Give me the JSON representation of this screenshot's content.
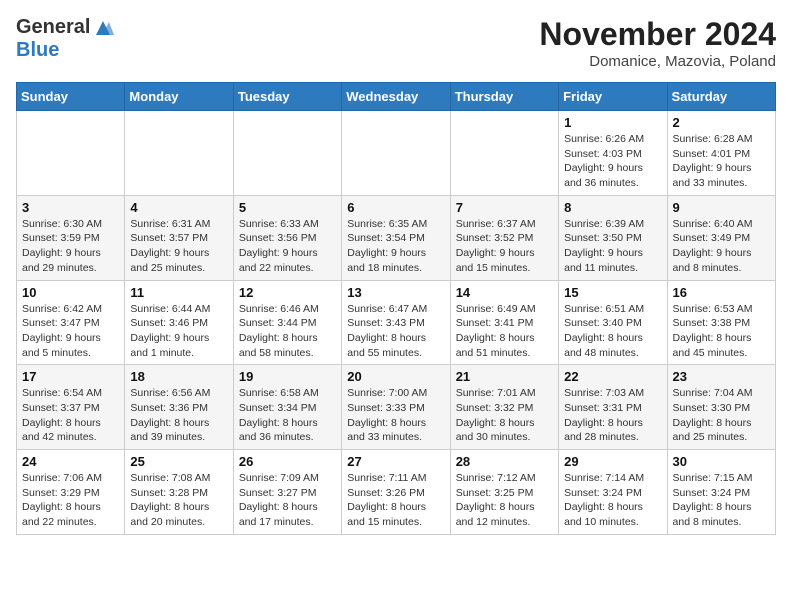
{
  "header": {
    "logo": {
      "text_general": "General",
      "text_blue": "Blue"
    },
    "title": "November 2024",
    "location": "Domanice, Mazovia, Poland"
  },
  "calendar": {
    "days_of_week": [
      "Sunday",
      "Monday",
      "Tuesday",
      "Wednesday",
      "Thursday",
      "Friday",
      "Saturday"
    ],
    "weeks": [
      [
        {
          "day": "",
          "info": ""
        },
        {
          "day": "",
          "info": ""
        },
        {
          "day": "",
          "info": ""
        },
        {
          "day": "",
          "info": ""
        },
        {
          "day": "",
          "info": ""
        },
        {
          "day": "1",
          "info": "Sunrise: 6:26 AM\nSunset: 4:03 PM\nDaylight: 9 hours and 36 minutes."
        },
        {
          "day": "2",
          "info": "Sunrise: 6:28 AM\nSunset: 4:01 PM\nDaylight: 9 hours and 33 minutes."
        }
      ],
      [
        {
          "day": "3",
          "info": "Sunrise: 6:30 AM\nSunset: 3:59 PM\nDaylight: 9 hours and 29 minutes."
        },
        {
          "day": "4",
          "info": "Sunrise: 6:31 AM\nSunset: 3:57 PM\nDaylight: 9 hours and 25 minutes."
        },
        {
          "day": "5",
          "info": "Sunrise: 6:33 AM\nSunset: 3:56 PM\nDaylight: 9 hours and 22 minutes."
        },
        {
          "day": "6",
          "info": "Sunrise: 6:35 AM\nSunset: 3:54 PM\nDaylight: 9 hours and 18 minutes."
        },
        {
          "day": "7",
          "info": "Sunrise: 6:37 AM\nSunset: 3:52 PM\nDaylight: 9 hours and 15 minutes."
        },
        {
          "day": "8",
          "info": "Sunrise: 6:39 AM\nSunset: 3:50 PM\nDaylight: 9 hours and 11 minutes."
        },
        {
          "day": "9",
          "info": "Sunrise: 6:40 AM\nSunset: 3:49 PM\nDaylight: 9 hours and 8 minutes."
        }
      ],
      [
        {
          "day": "10",
          "info": "Sunrise: 6:42 AM\nSunset: 3:47 PM\nDaylight: 9 hours and 5 minutes."
        },
        {
          "day": "11",
          "info": "Sunrise: 6:44 AM\nSunset: 3:46 PM\nDaylight: 9 hours and 1 minute."
        },
        {
          "day": "12",
          "info": "Sunrise: 6:46 AM\nSunset: 3:44 PM\nDaylight: 8 hours and 58 minutes."
        },
        {
          "day": "13",
          "info": "Sunrise: 6:47 AM\nSunset: 3:43 PM\nDaylight: 8 hours and 55 minutes."
        },
        {
          "day": "14",
          "info": "Sunrise: 6:49 AM\nSunset: 3:41 PM\nDaylight: 8 hours and 51 minutes."
        },
        {
          "day": "15",
          "info": "Sunrise: 6:51 AM\nSunset: 3:40 PM\nDaylight: 8 hours and 48 minutes."
        },
        {
          "day": "16",
          "info": "Sunrise: 6:53 AM\nSunset: 3:38 PM\nDaylight: 8 hours and 45 minutes."
        }
      ],
      [
        {
          "day": "17",
          "info": "Sunrise: 6:54 AM\nSunset: 3:37 PM\nDaylight: 8 hours and 42 minutes."
        },
        {
          "day": "18",
          "info": "Sunrise: 6:56 AM\nSunset: 3:36 PM\nDaylight: 8 hours and 39 minutes."
        },
        {
          "day": "19",
          "info": "Sunrise: 6:58 AM\nSunset: 3:34 PM\nDaylight: 8 hours and 36 minutes."
        },
        {
          "day": "20",
          "info": "Sunrise: 7:00 AM\nSunset: 3:33 PM\nDaylight: 8 hours and 33 minutes."
        },
        {
          "day": "21",
          "info": "Sunrise: 7:01 AM\nSunset: 3:32 PM\nDaylight: 8 hours and 30 minutes."
        },
        {
          "day": "22",
          "info": "Sunrise: 7:03 AM\nSunset: 3:31 PM\nDaylight: 8 hours and 28 minutes."
        },
        {
          "day": "23",
          "info": "Sunrise: 7:04 AM\nSunset: 3:30 PM\nDaylight: 8 hours and 25 minutes."
        }
      ],
      [
        {
          "day": "24",
          "info": "Sunrise: 7:06 AM\nSunset: 3:29 PM\nDaylight: 8 hours and 22 minutes."
        },
        {
          "day": "25",
          "info": "Sunrise: 7:08 AM\nSunset: 3:28 PM\nDaylight: 8 hours and 20 minutes."
        },
        {
          "day": "26",
          "info": "Sunrise: 7:09 AM\nSunset: 3:27 PM\nDaylight: 8 hours and 17 minutes."
        },
        {
          "day": "27",
          "info": "Sunrise: 7:11 AM\nSunset: 3:26 PM\nDaylight: 8 hours and 15 minutes."
        },
        {
          "day": "28",
          "info": "Sunrise: 7:12 AM\nSunset: 3:25 PM\nDaylight: 8 hours and 12 minutes."
        },
        {
          "day": "29",
          "info": "Sunrise: 7:14 AM\nSunset: 3:24 PM\nDaylight: 8 hours and 10 minutes."
        },
        {
          "day": "30",
          "info": "Sunrise: 7:15 AM\nSunset: 3:24 PM\nDaylight: 8 hours and 8 minutes."
        }
      ]
    ]
  }
}
